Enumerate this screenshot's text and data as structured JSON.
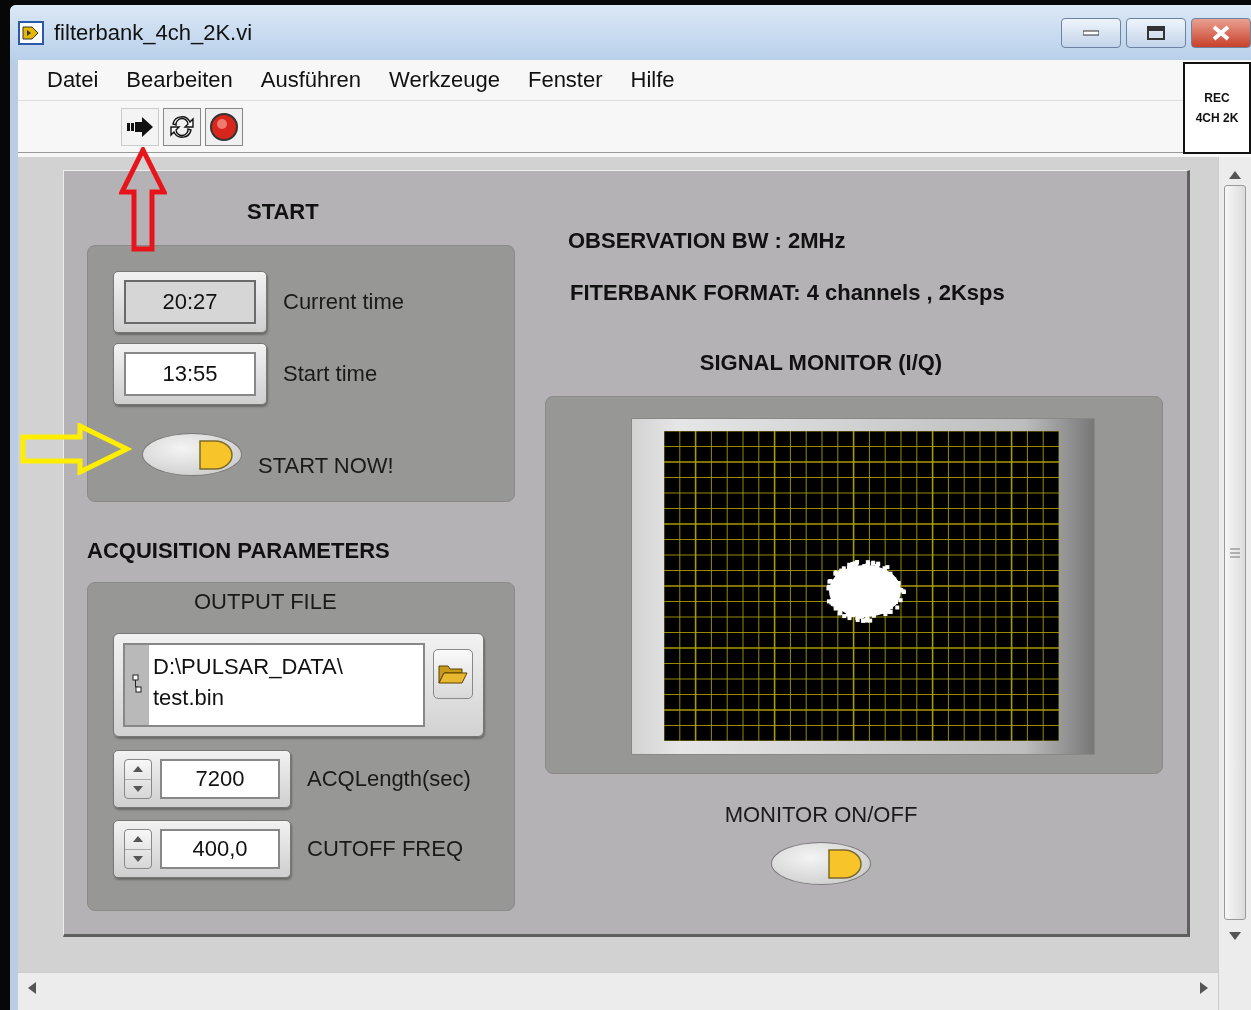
{
  "window": {
    "title": "filterbank_4ch_2K.vi"
  },
  "menu": [
    "Datei",
    "Bearbeiten",
    "Ausführen",
    "Werkzeuge",
    "Fenster",
    "Hilfe"
  ],
  "vi_icon": {
    "lines": [
      "REC",
      "4CH 2K"
    ]
  },
  "start": {
    "title": "START",
    "times": [
      {
        "kind": "indicator",
        "value": "20:27",
        "label": "Current time"
      },
      {
        "kind": "control",
        "value": "13:55",
        "label": "Start time"
      }
    ],
    "start_now": {
      "label": "START NOW!",
      "on": true
    }
  },
  "acquisition": {
    "title": "ACQUISITION PARAMETERS",
    "output_file": {
      "label": "OUTPUT FILE",
      "path": [
        "D:\\PULSAR_DATA\\",
        "test.bin"
      ]
    },
    "numerics": [
      {
        "value": "7200",
        "label": "ACQLength(sec)"
      },
      {
        "value": "400,0",
        "label": "CUTOFF FREQ"
      }
    ]
  },
  "info": [
    "OBSERVATION BW : 2MHz",
    "FITERBANK FORMAT: 4 channels , 2Ksps"
  ],
  "monitor": {
    "title": "SIGNAL MONITOR (I/Q)",
    "toggle": {
      "label": "MONITOR ON/OFF",
      "on": true
    }
  }
}
